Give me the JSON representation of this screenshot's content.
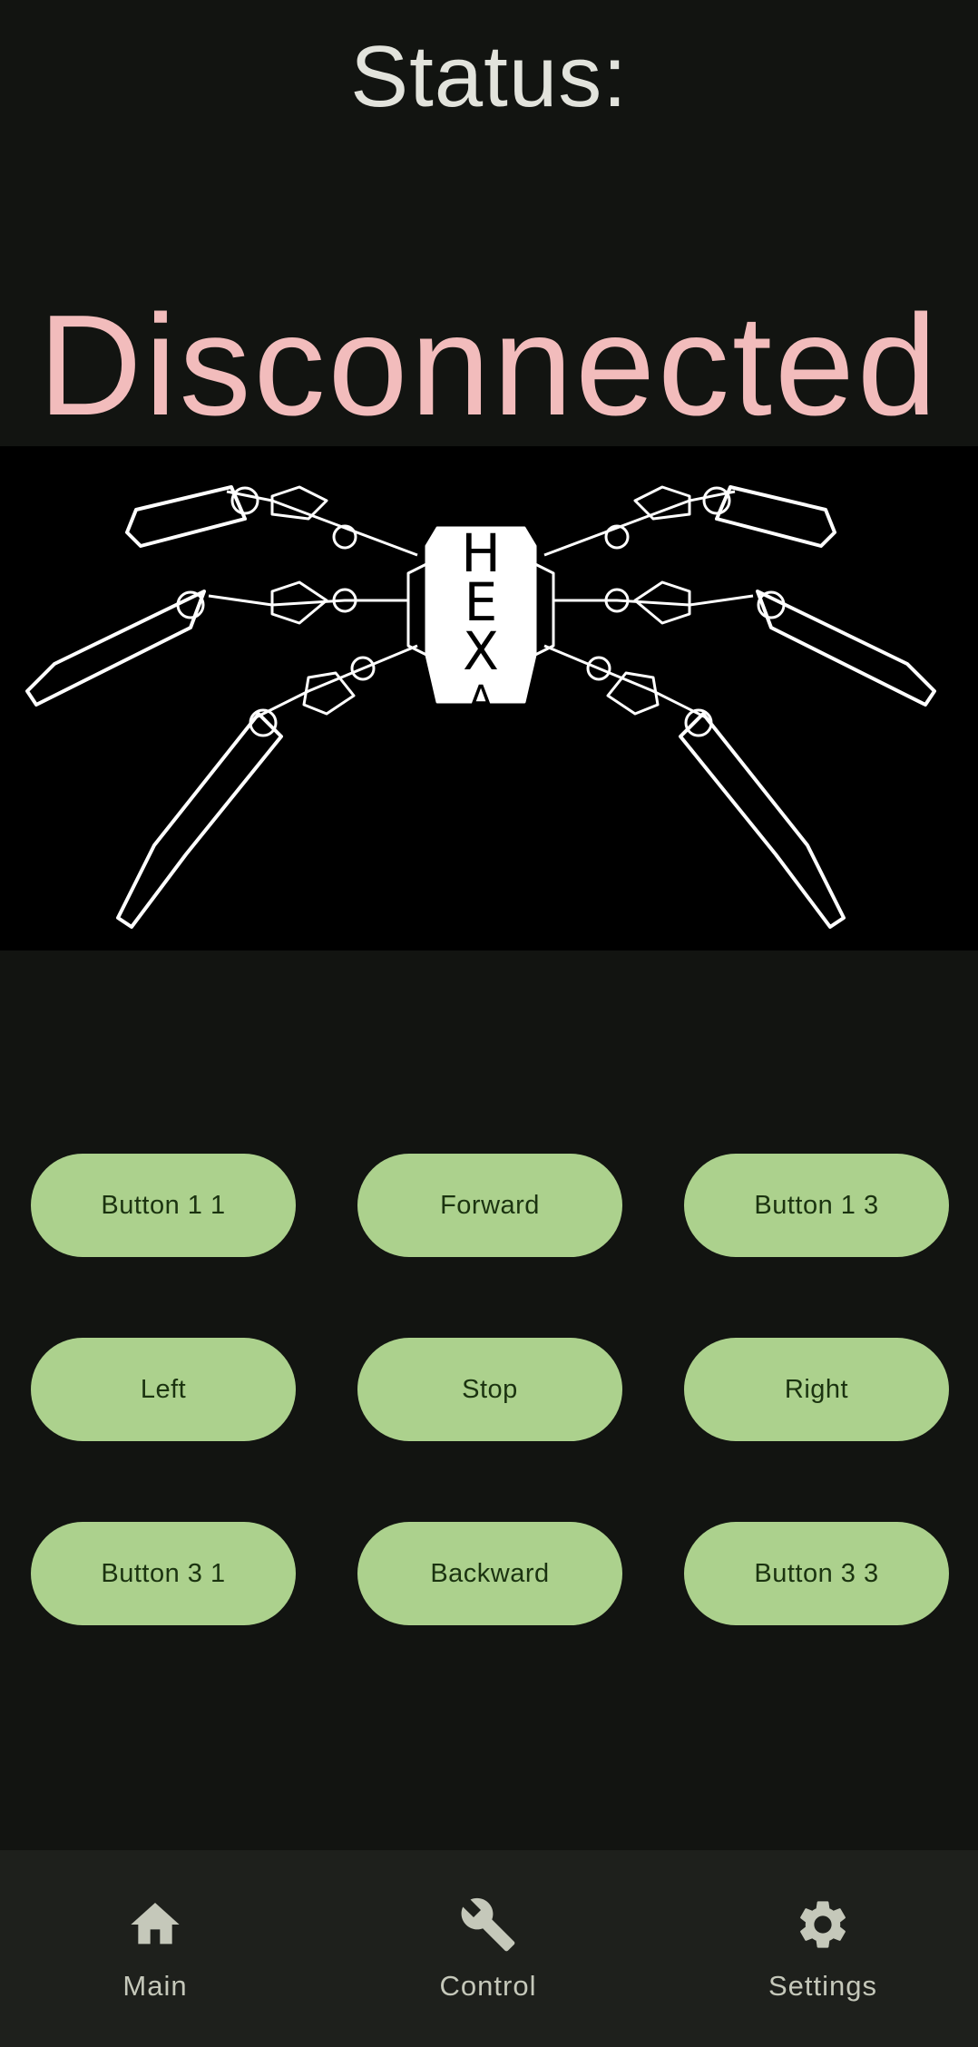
{
  "status": {
    "label": "Status:",
    "value": "Disconnected"
  },
  "robot_image": {
    "description_logo_text": "HEXA"
  },
  "controls": {
    "row1": [
      "Button 1 1",
      "Forward",
      "Button 1 3"
    ],
    "row2": [
      "Left",
      "Stop",
      "Right"
    ],
    "row3": [
      "Button 3 1",
      "Backward",
      "Button 3 3"
    ]
  },
  "nav": {
    "items": [
      {
        "label": "Main",
        "icon": "home-icon"
      },
      {
        "label": "Control",
        "icon": "wrench-icon"
      },
      {
        "label": "Settings",
        "icon": "gear-icon"
      }
    ]
  },
  "colors": {
    "background": "#121411",
    "status_value": "#f2bcbc",
    "button": "#acd18d",
    "button_text": "#1b3310",
    "nav_background": "#1e201c"
  }
}
